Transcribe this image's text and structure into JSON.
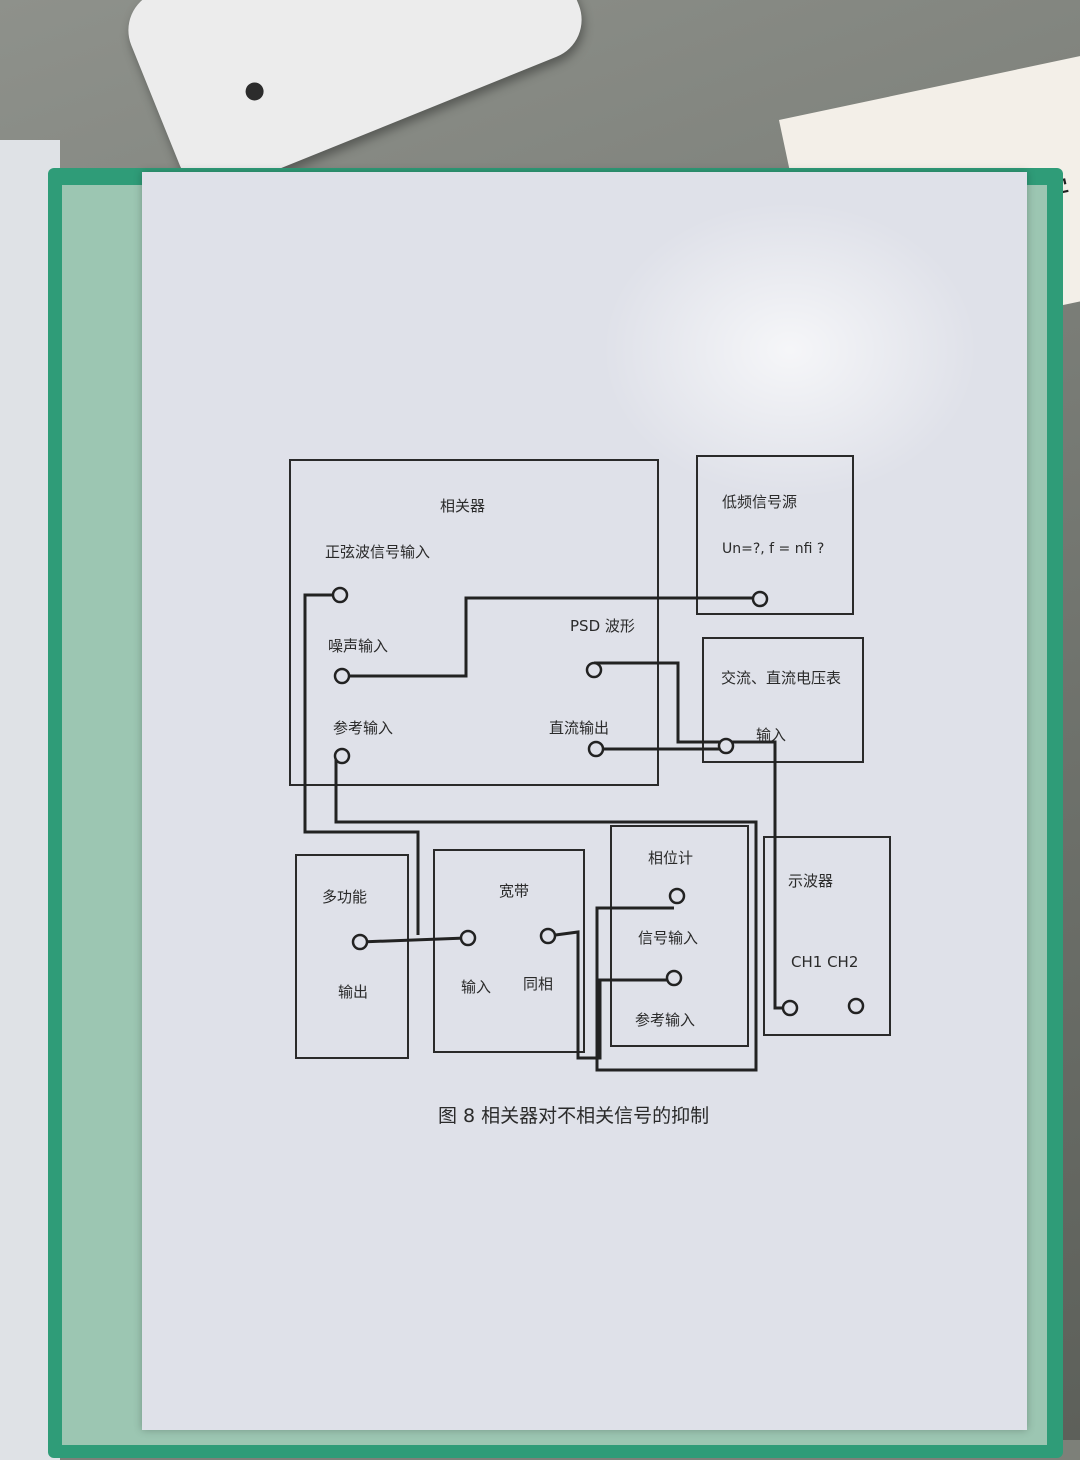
{
  "background": {
    "notebook_title": "数 学"
  },
  "diagram": {
    "correlator": {
      "title": "相关器",
      "sine_input": "正弦波信号输入",
      "noise_input": "噪声输入",
      "psd_waveform": "PSD 波形",
      "reference_input": "参考输入",
      "dc_output": "直流输出"
    },
    "lf_source": {
      "title": "低频信号源",
      "params": "Un=?,   f = nfi ?"
    },
    "voltmeter": {
      "title": "交流、直流电压表",
      "input": "输入"
    },
    "multifunction": {
      "title": "多功能",
      "output": "输出"
    },
    "broadband": {
      "title": "宽带",
      "input": "输入",
      "inphase": "同相"
    },
    "phase_meter": {
      "title": "相位计",
      "signal_input": "信号输入",
      "reference_input": "参考输入"
    },
    "oscilloscope": {
      "title": "示波器",
      "channels": "CH1 CH2"
    },
    "caption": "图 8   相关器对不相关信号的抑制"
  }
}
